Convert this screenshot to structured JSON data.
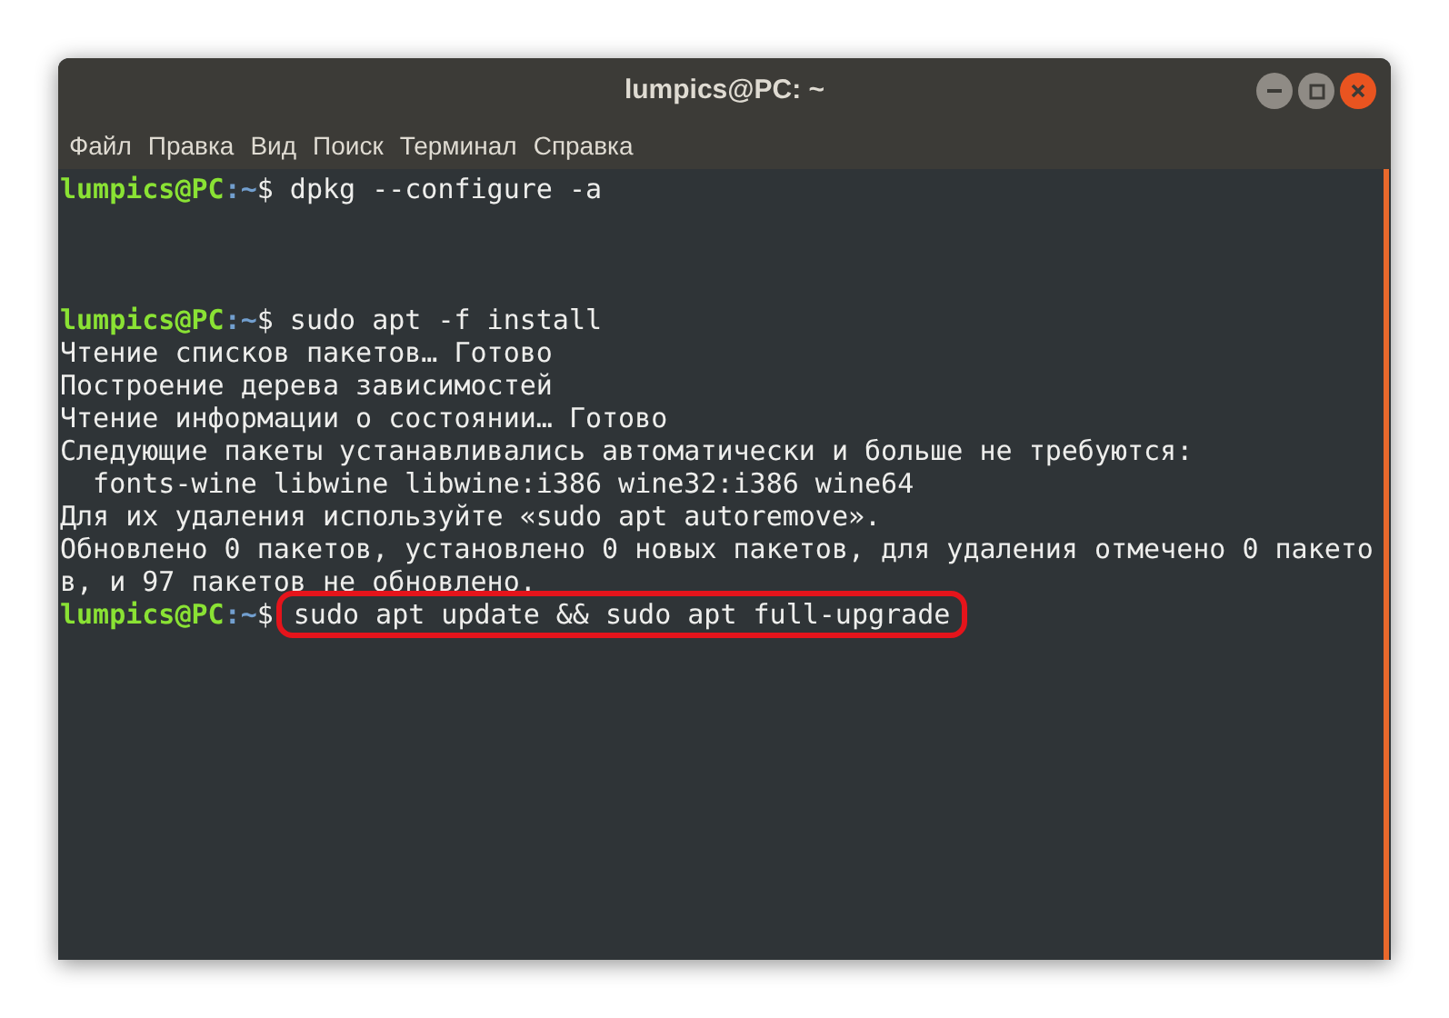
{
  "window": {
    "title": "lumpics@PC: ~"
  },
  "menu": [
    "Файл",
    "Правка",
    "Вид",
    "Поиск",
    "Терминал",
    "Справка"
  ],
  "terminal": {
    "lines": [
      {
        "kind": "command",
        "user": "lumpics@PC",
        "path": ":~",
        "symbol": "$",
        "text": "dpkg --configure -a",
        "highlighted": false
      },
      {
        "kind": "blank"
      },
      {
        "kind": "blank"
      },
      {
        "kind": "blank"
      },
      {
        "kind": "command",
        "user": "lumpics@PC",
        "path": ":~",
        "symbol": "$",
        "text": "sudo apt -f install",
        "highlighted": false
      },
      {
        "kind": "output",
        "text": "Чтение списков пакетов… Готово"
      },
      {
        "kind": "output",
        "text": "Построение дерева зависимостей"
      },
      {
        "kind": "output",
        "text": "Чтение информации о состоянии… Готово"
      },
      {
        "kind": "output",
        "text": "Следующие пакеты устанавливались автоматически и больше не требуются:"
      },
      {
        "kind": "output",
        "text": "  fonts-wine libwine libwine:i386 wine32:i386 wine64"
      },
      {
        "kind": "output",
        "text": "Для их удаления используйте «sudo apt autoremove»."
      },
      {
        "kind": "output",
        "text": "Обновлено 0 пакетов, установлено 0 новых пакетов, для удаления отмечено 0 пакето"
      },
      {
        "kind": "output",
        "text": "в, и 97 пакетов не обновлено."
      },
      {
        "kind": "command",
        "user": "lumpics@PC",
        "path": ":~",
        "symbol": "$",
        "text": "sudo apt update && sudo apt full-upgrade",
        "highlighted": true
      }
    ]
  }
}
